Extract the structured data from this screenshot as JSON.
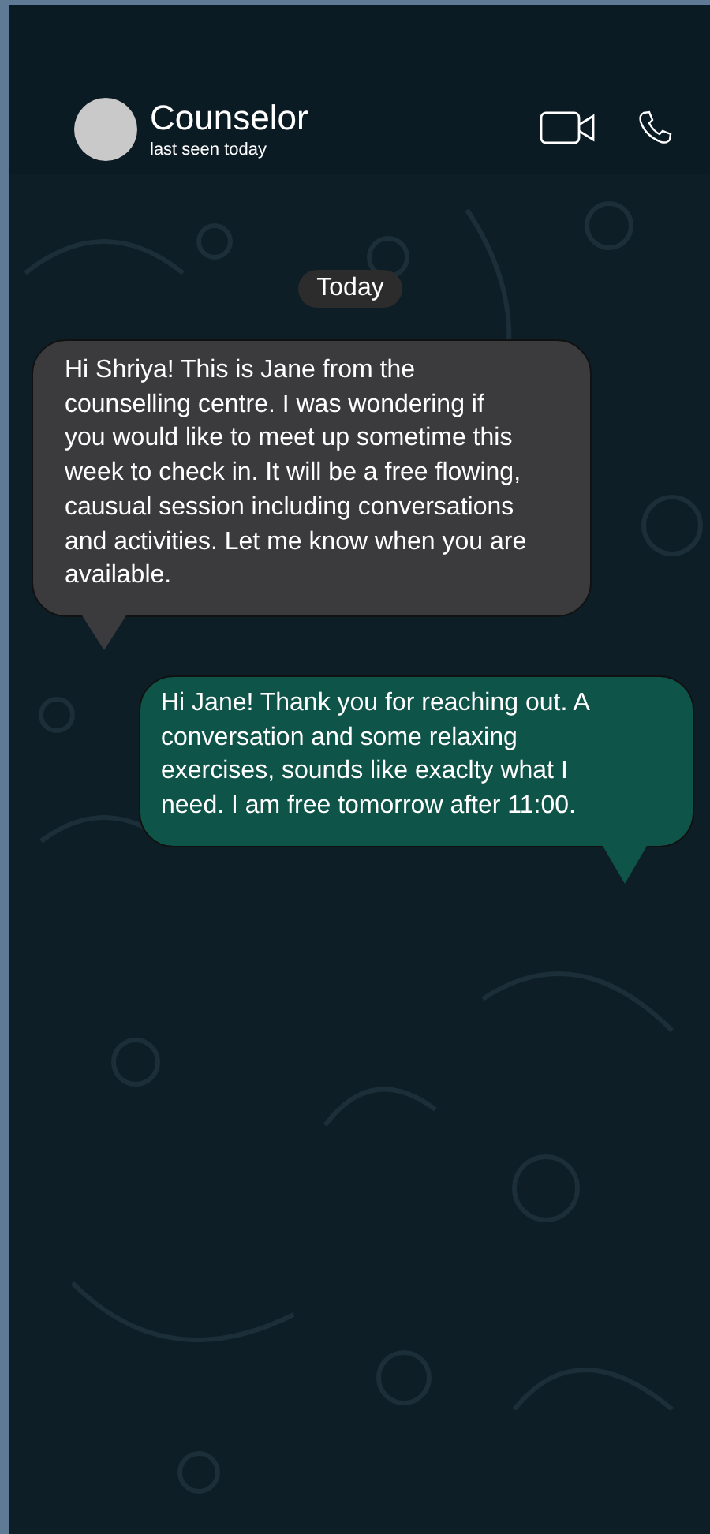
{
  "header": {
    "contact_name": "Counselor",
    "status": "last seen today"
  },
  "date_separator": "Today",
  "messages": [
    {
      "kind": "incoming",
      "text": "Hi Shriya! This is Jane from the counselling centre. I was wondering if you would like to meet up sometime this week to check in. It will be a free flowing, causual session including conversations and activities. Let me know when you are available."
    },
    {
      "kind": "outgoing",
      "text": "Hi Jane! Thank you for reaching out. A conversation and some relaxing exercises, sounds like exaclty what I need. I am free tomorrow after 11:00."
    }
  ]
}
